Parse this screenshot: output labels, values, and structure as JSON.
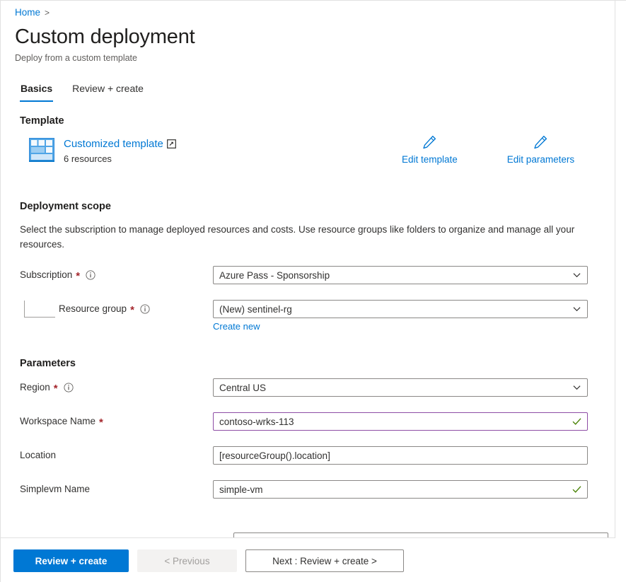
{
  "breadcrumb": {
    "home_label": "Home",
    "separator": ">"
  },
  "header": {
    "title": "Custom deployment",
    "subtitle": "Deploy from a custom template"
  },
  "tabs": [
    {
      "label": "Basics",
      "active": true
    },
    {
      "label": "Review + create",
      "active": false
    }
  ],
  "template_section": {
    "heading": "Template",
    "icon_name": "template-grid-icon",
    "link_label": "Customized template",
    "external_icon_name": "external-link-icon",
    "resource_count": "6 resources",
    "actions": [
      {
        "label": "Edit template",
        "icon_name": "pencil-icon"
      },
      {
        "label": "Edit parameters",
        "icon_name": "pencil-icon"
      }
    ]
  },
  "deployment_scope": {
    "heading": "Deployment scope",
    "description": "Select the subscription to manage deployed resources and costs. Use resource groups like folders to organize and manage all your resources.",
    "fields": {
      "subscription": {
        "label": "Subscription",
        "required": "*",
        "value": "Azure Pass - Sponsorship"
      },
      "resource_group": {
        "label": "Resource group",
        "required": "*",
        "value": "(New) sentinel-rg",
        "create_new_label": "Create new"
      }
    }
  },
  "parameters": {
    "heading": "Parameters",
    "fields": [
      {
        "label": "Region",
        "required": "*",
        "has_info": true,
        "type": "dropdown",
        "value": "Central US",
        "valid": false,
        "focused": false
      },
      {
        "label": "Workspace Name",
        "required": "*",
        "has_info": false,
        "type": "textbox",
        "value": "contoso-wrks-113",
        "valid": true,
        "focused": true
      },
      {
        "label": "Location",
        "required": "",
        "has_info": false,
        "type": "textbox",
        "value": "[resourceGroup().location]",
        "valid": false,
        "focused": false
      },
      {
        "label": "Simplevm Name",
        "required": "",
        "has_info": false,
        "type": "textbox",
        "value": "simple-vm",
        "valid": true,
        "focused": false
      }
    ]
  },
  "footer": {
    "review_create_label": "Review + create",
    "previous_label": "< Previous",
    "next_label": "Next : Review + create >"
  },
  "colors": {
    "accent_blue": "#0078d4",
    "link_blue": "#0078d4",
    "required_red": "#a4262c",
    "valid_green": "#498205",
    "focus_purple": "#8e4da5",
    "border_gray": "#8a8886"
  }
}
